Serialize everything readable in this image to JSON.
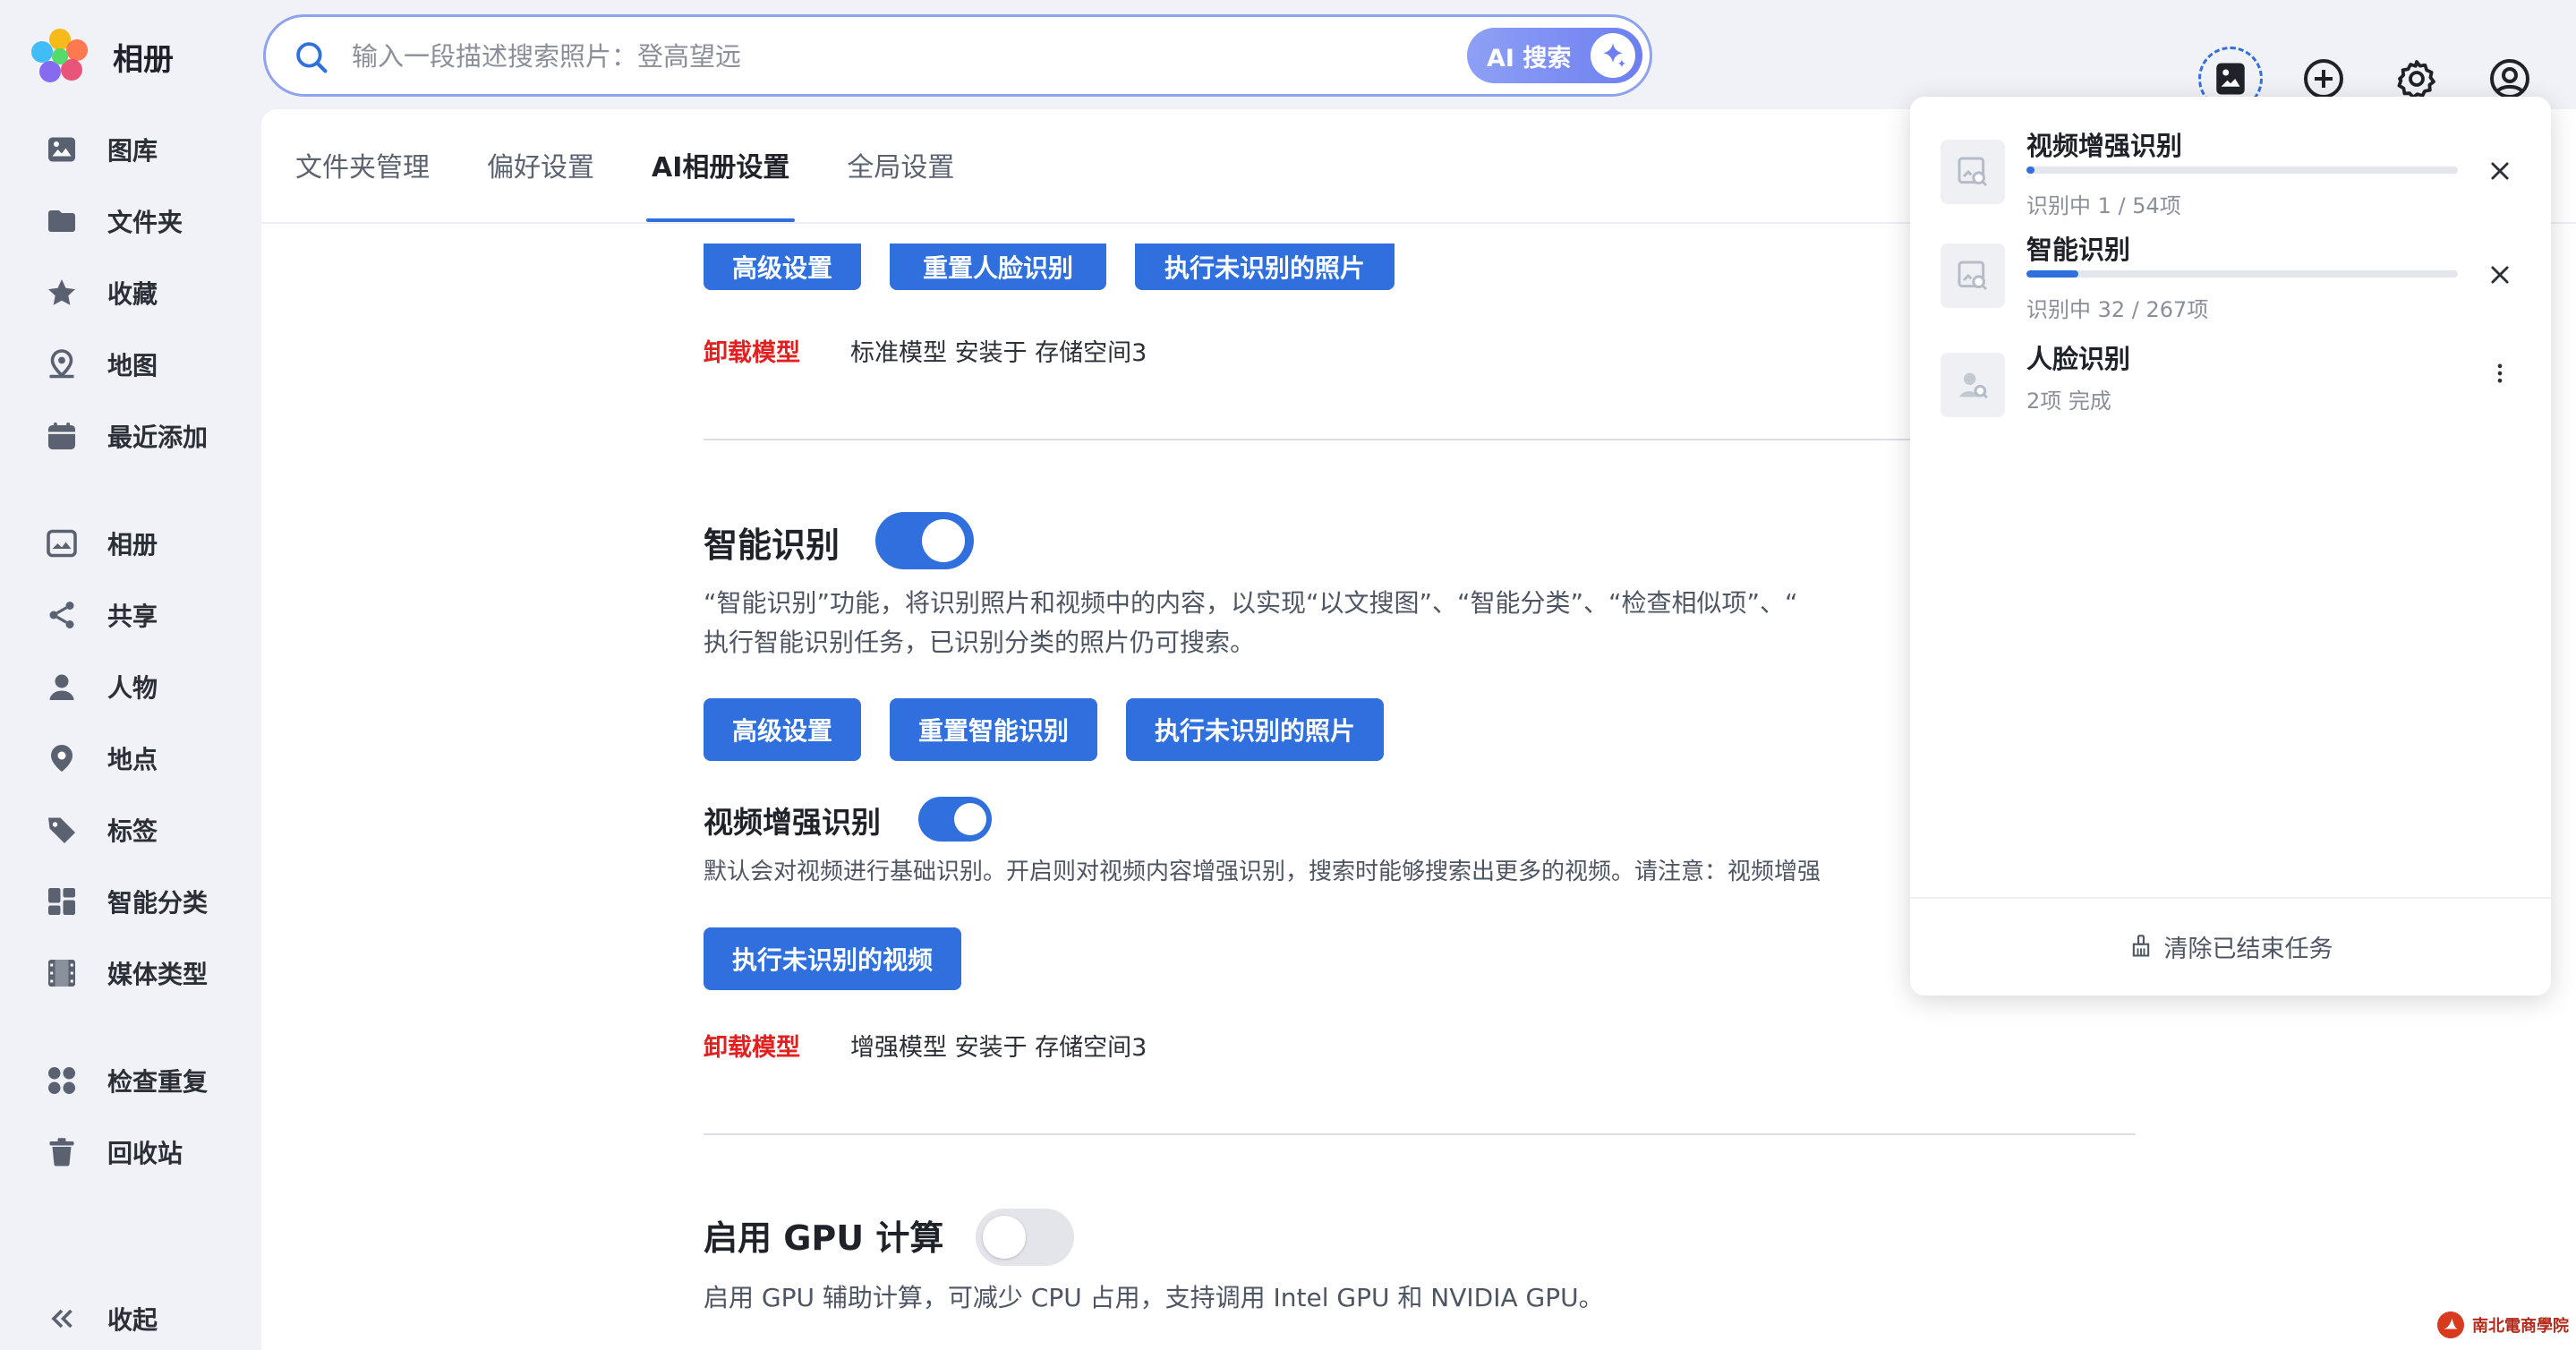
{
  "app": {
    "title": "相册"
  },
  "sidebar": {
    "items": [
      {
        "label": "图库",
        "icon": "image-icon"
      },
      {
        "label": "文件夹",
        "icon": "folder-icon"
      },
      {
        "label": "收藏",
        "icon": "star-icon"
      },
      {
        "label": "地图",
        "icon": "map-pin-icon"
      },
      {
        "label": "最近添加",
        "icon": "calendar-icon"
      },
      {
        "label": "相册",
        "icon": "album-icon"
      },
      {
        "label": "共享",
        "icon": "share-icon"
      },
      {
        "label": "人物",
        "icon": "person-icon"
      },
      {
        "label": "地点",
        "icon": "location-icon"
      },
      {
        "label": "标签",
        "icon": "tag-icon"
      },
      {
        "label": "智能分类",
        "icon": "grid-icon"
      },
      {
        "label": "媒体类型",
        "icon": "film-icon"
      },
      {
        "label": "检查重复",
        "icon": "duplicate-icon"
      },
      {
        "label": "回收站",
        "icon": "trash-icon"
      }
    ],
    "collapse_label": "收起"
  },
  "search": {
    "placeholder": "输入一段描述搜索照片：登高望远",
    "ai_button": "AI 搜索"
  },
  "tabs": [
    {
      "label": "文件夹管理",
      "active": false
    },
    {
      "label": "偏好设置",
      "active": false
    },
    {
      "label": "AI相册设置",
      "active": true
    },
    {
      "label": "全局设置",
      "active": false
    }
  ],
  "face_section": {
    "buttons": [
      "高级设置",
      "重置人脸识别",
      "执行未识别的照片"
    ],
    "unload_label": "卸载模型",
    "model_info": "标准模型 安装于 存储空间3"
  },
  "smart_section": {
    "title": "智能识别",
    "enabled": true,
    "desc_line1": "“智能识别”功能，将识别照片和视频中的内容，以实现“以文搜图”、“智能分类”、“检查相似项”、“",
    "desc_line2": "执行智能识别任务，已识别分类的照片仍可搜索。",
    "buttons": [
      "高级设置",
      "重置智能识别",
      "执行未识别的照片"
    ]
  },
  "video_section": {
    "title": "视频增强识别",
    "enabled": true,
    "desc": "默认会对视频进行基础识别。开启则对视频内容增强识别，搜索时能够搜索出更多的视频。请注意：视频增强",
    "button": "执行未识别的视频",
    "unload_label": "卸载模型",
    "model_info": "增强模型 安装于 存储空间3"
  },
  "gpu_section": {
    "title": "启用 GPU 计算",
    "enabled": false,
    "desc": "启用 GPU 辅助计算，可减少 CPU 占用，支持调用 Intel GPU 和 NVIDIA GPU。"
  },
  "tasks": {
    "items": [
      {
        "name": "视频增强识别",
        "status": "识别中 1 / 54项",
        "progress": 0.0185,
        "action": "close-icon"
      },
      {
        "name": "智能识别",
        "status": "识别中 32 / 267项",
        "progress": 0.1199,
        "action": "close-icon"
      },
      {
        "name": "人脸识别",
        "status": "2项 完成",
        "progress": 1.0,
        "action": "more-vertical-icon"
      }
    ],
    "clear_label": "清除已结束任务"
  },
  "colors": {
    "accent": "#2f6fde",
    "danger": "#e0211f",
    "toggle_off": "#e3e5ea"
  },
  "watermark": {
    "text": "南北電商學院"
  }
}
